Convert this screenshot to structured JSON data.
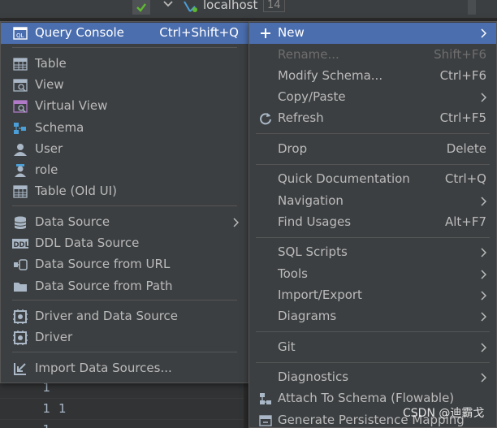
{
  "background": {
    "tree_node_label": "localhost",
    "tree_node_count": "14",
    "rows": [
      {
        "num": "1",
        "value": ""
      },
      {
        "num": "1",
        "value": "1"
      },
      {
        "num": "1",
        "value": ""
      }
    ]
  },
  "left_menu": {
    "items": [
      {
        "label": "Query Console",
        "shortcut": "Ctrl+Shift+Q",
        "icon": "query-console-icon"
      },
      {
        "label": "Table",
        "icon": "table-icon"
      },
      {
        "label": "View",
        "icon": "view-icon"
      },
      {
        "label": "Virtual View",
        "icon": "virtual-view-icon"
      },
      {
        "label": "Schema",
        "icon": "schema-icon"
      },
      {
        "label": "User",
        "icon": "user-icon"
      },
      {
        "label": "role",
        "icon": "role-icon"
      },
      {
        "label": "Table (Old UI)",
        "icon": "table-old-ui-icon"
      },
      {
        "label": "Data Source",
        "icon": "data-source-icon",
        "submenu": true
      },
      {
        "label": "DDL Data Source",
        "icon": "ddl-data-source-icon"
      },
      {
        "label": "Data Source from URL",
        "icon": "data-source-url-icon"
      },
      {
        "label": "Data Source from Path",
        "icon": "folder-icon"
      },
      {
        "label": "Driver and Data Source",
        "icon": "driver-and-data-source-icon"
      },
      {
        "label": "Driver",
        "icon": "driver-icon"
      },
      {
        "label": "Import Data Sources...",
        "icon": "import-icon"
      }
    ]
  },
  "right_menu": {
    "items": [
      {
        "label": "New",
        "icon": "plus-icon",
        "submenu": true
      },
      {
        "label": "Rename...",
        "shortcut": "Shift+F6",
        "disabled": true
      },
      {
        "label": "Modify Schema...",
        "shortcut": "Ctrl+F6"
      },
      {
        "label": "Copy/Paste",
        "submenu": true
      },
      {
        "label": "Refresh",
        "shortcut": "Ctrl+F5",
        "icon": "refresh-icon"
      },
      {
        "label": "Drop",
        "shortcut": "Delete"
      },
      {
        "label": "Quick Documentation",
        "shortcut": "Ctrl+Q"
      },
      {
        "label": "Navigation",
        "submenu": true
      },
      {
        "label": "Find Usages",
        "shortcut": "Alt+F7"
      },
      {
        "label": "SQL Scripts",
        "submenu": true
      },
      {
        "label": "Tools",
        "submenu": true
      },
      {
        "label": "Import/Export",
        "submenu": true
      },
      {
        "label": "Diagrams",
        "submenu": true
      },
      {
        "label": "Git",
        "submenu": true
      },
      {
        "label": "Diagnostics",
        "submenu": true
      },
      {
        "label": "Attach To Schema (Flowable)",
        "icon": "attach-schema-icon"
      },
      {
        "label": "Generate Persistence Mapping",
        "icon": "persistence-mapping-icon"
      }
    ]
  },
  "watermark": "CSDN @迪霸戈",
  "colors": {
    "selection": "#4b6eaf",
    "menu_bg": "#3c3f41",
    "text": "#bbbbbb",
    "disabled_text": "#6e6e6e",
    "check_green": "#5fb832"
  }
}
